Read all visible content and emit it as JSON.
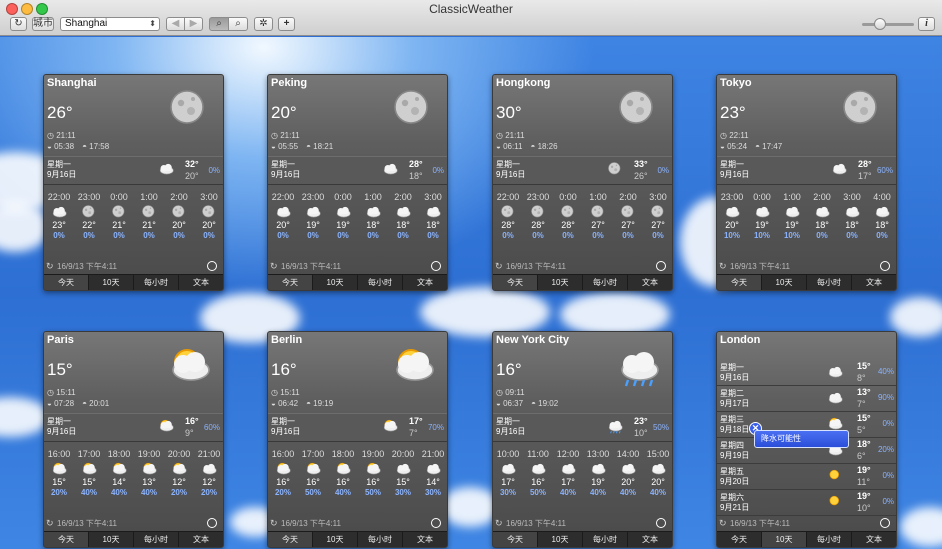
{
  "app": {
    "title": "ClassicWeather"
  },
  "toolbar": {
    "refresh_glyph": "↻",
    "city_button_label": "城市",
    "city_selected": "Shanghai",
    "back_glyph": "◀",
    "forward_glyph": "▶",
    "search_glyph": "⌕",
    "settings_glyph": "✲",
    "add_glyph": "+",
    "info_glyph": "i",
    "zoom_level": 0.35
  },
  "cards": [
    {
      "city": "Shanghai",
      "temp": "26°",
      "icon": "moon-icon",
      "time": "21:11",
      "sunrise": "05:38",
      "sunset": "17:58",
      "today": {
        "day": "星期一",
        "date": "9月16日",
        "icon": "cloud-icon",
        "hi": "32°",
        "lo": "20°",
        "precip": "0%"
      },
      "hours": [
        {
          "t": "22:00",
          "i": "cloud-icon",
          "temp": "23°",
          "p": "0%"
        },
        {
          "t": "23:00",
          "i": "moon-icon",
          "temp": "22°",
          "p": "0%"
        },
        {
          "t": "0:00",
          "i": "moon-icon",
          "temp": "21°",
          "p": "0%"
        },
        {
          "t": "1:00",
          "i": "moon-icon",
          "temp": "21°",
          "p": "0%"
        },
        {
          "t": "2:00",
          "i": "moon-icon",
          "temp": "20°",
          "p": "0%"
        },
        {
          "t": "3:00",
          "i": "moon-icon",
          "temp": "20°",
          "p": "0%"
        }
      ],
      "updated": "16/9/13 下午4:11",
      "tabs": [
        "今天",
        "10天",
        "每小时",
        "文本"
      ],
      "selected_tab": 0
    },
    {
      "city": "Peking",
      "temp": "20°",
      "icon": "moon-icon",
      "time": "21:11",
      "sunrise": "05:55",
      "sunset": "18:21",
      "today": {
        "day": "星期一",
        "date": "9月16日",
        "icon": "cloud-icon",
        "hi": "28°",
        "lo": "18°",
        "precip": "0%"
      },
      "hours": [
        {
          "t": "22:00",
          "i": "cloud-icon",
          "temp": "20°",
          "p": "0%"
        },
        {
          "t": "23:00",
          "i": "cloud-icon",
          "temp": "19°",
          "p": "0%"
        },
        {
          "t": "0:00",
          "i": "cloud-icon",
          "temp": "19°",
          "p": "0%"
        },
        {
          "t": "1:00",
          "i": "cloud-icon",
          "temp": "18°",
          "p": "0%"
        },
        {
          "t": "2:00",
          "i": "cloud-icon",
          "temp": "18°",
          "p": "0%"
        },
        {
          "t": "3:00",
          "i": "cloud-icon",
          "temp": "18°",
          "p": "0%"
        }
      ],
      "updated": "16/9/13 下午4:11",
      "tabs": [
        "今天",
        "10天",
        "每小时",
        "文本"
      ],
      "selected_tab": 0
    },
    {
      "city": "Hongkong",
      "temp": "30°",
      "icon": "moon-icon",
      "time": "21:11",
      "sunrise": "06:11",
      "sunset": "18:26",
      "today": {
        "day": "星期一",
        "date": "9月16日",
        "icon": "moon-icon",
        "hi": "33°",
        "lo": "26°",
        "precip": "0%"
      },
      "hours": [
        {
          "t": "22:00",
          "i": "moon-icon",
          "temp": "28°",
          "p": "0%"
        },
        {
          "t": "23:00",
          "i": "moon-icon",
          "temp": "28°",
          "p": "0%"
        },
        {
          "t": "0:00",
          "i": "moon-icon",
          "temp": "28°",
          "p": "0%"
        },
        {
          "t": "1:00",
          "i": "moon-icon",
          "temp": "27°",
          "p": "0%"
        },
        {
          "t": "2:00",
          "i": "moon-icon",
          "temp": "27°",
          "p": "0%"
        },
        {
          "t": "3:00",
          "i": "moon-icon",
          "temp": "27°",
          "p": "0%"
        }
      ],
      "updated": "16/9/13 下午4:11",
      "tabs": [
        "今天",
        "10天",
        "每小时",
        "文本"
      ],
      "selected_tab": 0
    },
    {
      "city": "Tokyo",
      "temp": "23°",
      "icon": "moon-icon",
      "time": "22:11",
      "sunrise": "05:24",
      "sunset": "17:47",
      "today": {
        "day": "星期一",
        "date": "9月16日",
        "icon": "cloud-icon",
        "hi": "28°",
        "lo": "17°",
        "precip": "60%"
      },
      "hours": [
        {
          "t": "23:00",
          "i": "cloud-icon",
          "temp": "20°",
          "p": "10%"
        },
        {
          "t": "0:00",
          "i": "cloud-icon",
          "temp": "19°",
          "p": "10%"
        },
        {
          "t": "1:00",
          "i": "cloud-icon",
          "temp": "19°",
          "p": "10%"
        },
        {
          "t": "2:00",
          "i": "cloud-icon",
          "temp": "18°",
          "p": "0%"
        },
        {
          "t": "3:00",
          "i": "cloud-icon",
          "temp": "18°",
          "p": "0%"
        },
        {
          "t": "4:00",
          "i": "cloud-icon",
          "temp": "18°",
          "p": "0%"
        }
      ],
      "updated": "16/9/13 下午4:11",
      "tabs": [
        "今天",
        "10天",
        "每小时",
        "文本"
      ],
      "selected_tab": 0
    },
    {
      "city": "Paris",
      "temp": "15°",
      "icon": "partly-cloudy-icon",
      "time": "15:11",
      "sunrise": "07:28",
      "sunset": "20:01",
      "today": {
        "day": "星期一",
        "date": "9月16日",
        "icon": "partly-cloudy-icon",
        "hi": "16°",
        "lo": "9°",
        "precip": "60%"
      },
      "hours": [
        {
          "t": "16:00",
          "i": "partly-cloudy-icon",
          "temp": "15°",
          "p": "20%"
        },
        {
          "t": "17:00",
          "i": "partly-cloudy-icon",
          "temp": "15°",
          "p": "40%"
        },
        {
          "t": "18:00",
          "i": "partly-cloudy-icon",
          "temp": "14°",
          "p": "40%"
        },
        {
          "t": "19:00",
          "i": "partly-cloudy-icon",
          "temp": "13°",
          "p": "40%"
        },
        {
          "t": "20:00",
          "i": "partly-cloudy-icon",
          "temp": "12°",
          "p": "20%"
        },
        {
          "t": "21:00",
          "i": "cloud-icon",
          "temp": "12°",
          "p": "20%"
        }
      ],
      "updated": "16/9/13 下午4:11",
      "tabs": [
        "今天",
        "10天",
        "每小时",
        "文本"
      ],
      "selected_tab": 0
    },
    {
      "city": "Berlin",
      "temp": "16°",
      "icon": "partly-cloudy-icon",
      "time": "15:11",
      "sunrise": "06:42",
      "sunset": "19:19",
      "today": {
        "day": "星期一",
        "date": "9月16日",
        "icon": "partly-cloudy-icon",
        "hi": "17°",
        "lo": "7°",
        "precip": "70%"
      },
      "hours": [
        {
          "t": "16:00",
          "i": "partly-cloudy-icon",
          "temp": "16°",
          "p": "20%"
        },
        {
          "t": "17:00",
          "i": "partly-cloudy-icon",
          "temp": "16°",
          "p": "50%"
        },
        {
          "t": "18:00",
          "i": "partly-cloudy-icon",
          "temp": "16°",
          "p": "40%"
        },
        {
          "t": "19:00",
          "i": "partly-cloudy-icon",
          "temp": "16°",
          "p": "50%"
        },
        {
          "t": "20:00",
          "i": "cloud-icon",
          "temp": "15°",
          "p": "30%"
        },
        {
          "t": "21:00",
          "i": "cloud-icon",
          "temp": "14°",
          "p": "30%"
        }
      ],
      "updated": "16/9/13 下午4:11",
      "tabs": [
        "今天",
        "10天",
        "每小时",
        "文本"
      ],
      "selected_tab": 0
    },
    {
      "city": "New York City",
      "temp": "16°",
      "icon": "rain-icon",
      "time": "09:11",
      "sunrise": "06:37",
      "sunset": "19:02",
      "today": {
        "day": "星期一",
        "date": "9月16日",
        "icon": "rain-icon",
        "hi": "23°",
        "lo": "10°",
        "precip": "50%"
      },
      "hours": [
        {
          "t": "10:00",
          "i": "cloud-icon",
          "temp": "17°",
          "p": "30%"
        },
        {
          "t": "11:00",
          "i": "cloud-icon",
          "temp": "16°",
          "p": "50%"
        },
        {
          "t": "12:00",
          "i": "cloud-icon",
          "temp": "17°",
          "p": "40%"
        },
        {
          "t": "13:00",
          "i": "cloud-icon",
          "temp": "19°",
          "p": "40%"
        },
        {
          "t": "14:00",
          "i": "cloud-icon",
          "temp": "20°",
          "p": "40%"
        },
        {
          "t": "15:00",
          "i": "cloud-icon",
          "temp": "20°",
          "p": "40%"
        }
      ],
      "updated": "16/9/13 下午4:11",
      "tabs": [
        "今天",
        "10天",
        "每小时",
        "文本"
      ],
      "selected_tab": 0
    }
  ],
  "london": {
    "city": "London",
    "days": [
      {
        "day": "星期一",
        "date": "9月16日",
        "icon": "cloud-icon",
        "hi": "15°",
        "lo": "8°",
        "precip": "40%"
      },
      {
        "day": "星期二",
        "date": "9月17日",
        "icon": "cloud-icon",
        "hi": "13°",
        "lo": "7°",
        "precip": "90%"
      },
      {
        "day": "星期三",
        "date": "9月18日",
        "icon": "partly-cloudy-icon",
        "hi": "15°",
        "lo": "5°",
        "precip": "0%"
      },
      {
        "day": "星期四",
        "date": "9月19日",
        "icon": "partly-cloudy-icon",
        "hi": "18°",
        "lo": "6°",
        "precip": "20%"
      },
      {
        "day": "星期五",
        "date": "9月20日",
        "icon": "sun-icon",
        "hi": "19°",
        "lo": "11°",
        "precip": "0%"
      },
      {
        "day": "星期六",
        "date": "9月21日",
        "icon": "sun-icon",
        "hi": "19°",
        "lo": "10°",
        "precip": "0%"
      }
    ],
    "updated": "16/9/13 下午4:11",
    "tabs": [
      "今天",
      "10天",
      "每小时",
      "文本"
    ],
    "selected_tab": 1,
    "popover": "降水可能性"
  }
}
